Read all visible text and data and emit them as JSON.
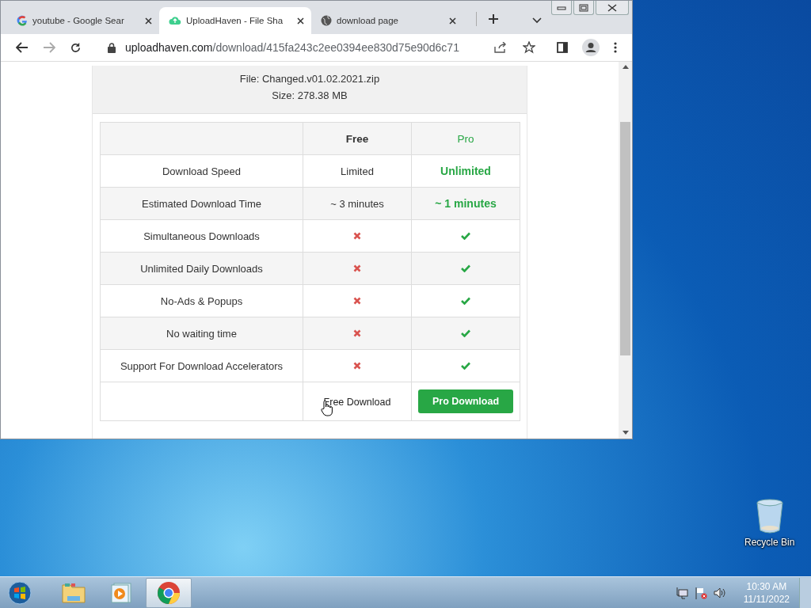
{
  "browser": {
    "tabs": [
      {
        "title": "youtube - Google Sear",
        "selected": false
      },
      {
        "title": "UploadHaven - File Sha",
        "selected": true
      },
      {
        "title": "download page",
        "selected": false
      }
    ],
    "url": {
      "domain": "uploadhaven.com",
      "path": "/download/415fa243c2ee0394ee830d75e90d6c71"
    }
  },
  "file_info": {
    "name": "File: Changed.v01.02.2021.zip",
    "size": "Size: 278.38 MB"
  },
  "comparison": {
    "columns": [
      "",
      "Free",
      "Pro"
    ],
    "rows": [
      {
        "feature": "Download Speed",
        "free": {
          "kind": "text",
          "text": "Limited"
        },
        "pro": {
          "kind": "text",
          "text": "Unlimited"
        }
      },
      {
        "feature": "Estimated Download Time",
        "free": {
          "kind": "text",
          "text": "~ 3 minutes"
        },
        "pro": {
          "kind": "text",
          "text": "~ 1 minutes"
        }
      },
      {
        "feature": "Simultaneous Downloads",
        "free": {
          "kind": "cross"
        },
        "pro": {
          "kind": "check"
        }
      },
      {
        "feature": "Unlimited Daily Downloads",
        "free": {
          "kind": "cross"
        },
        "pro": {
          "kind": "check"
        }
      },
      {
        "feature": "No-Ads & Popups",
        "free": {
          "kind": "cross"
        },
        "pro": {
          "kind": "check"
        }
      },
      {
        "feature": "No waiting time",
        "free": {
          "kind": "cross"
        },
        "pro": {
          "kind": "check"
        }
      },
      {
        "feature": "Support For Download Accelerators",
        "free": {
          "kind": "cross"
        },
        "pro": {
          "kind": "check"
        }
      }
    ],
    "free_button": "Free Download",
    "pro_button": "Pro Download"
  },
  "desktop": {
    "icons": [
      {
        "label": "Recycle Bin"
      }
    ]
  },
  "taskbar": {
    "apps": [
      {
        "kind": "explorer",
        "selected": false
      },
      {
        "kind": "media",
        "selected": false
      },
      {
        "kind": "chrome",
        "selected": true
      }
    ],
    "time": "10:30 AM",
    "date": "11/11/2022"
  }
}
